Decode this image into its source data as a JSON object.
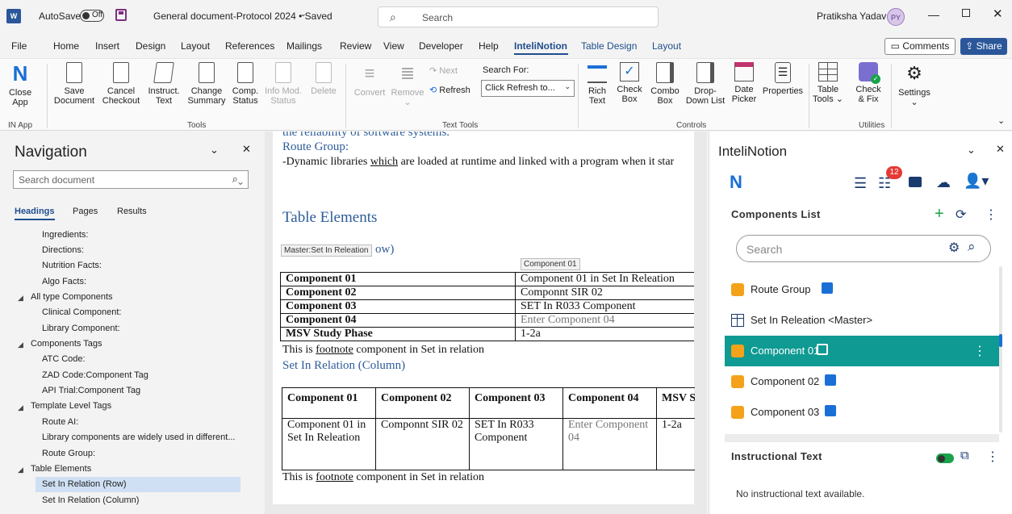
{
  "titlebar": {
    "autosave_label": "AutoSave",
    "autosave_state": "Off",
    "doc_title": "General document-Protocol 2024 • Saved",
    "search_placeholder": "Search",
    "user_name": "Pratiksha Yadav",
    "user_initials": "PY"
  },
  "menu": {
    "items": [
      "File",
      "Home",
      "Insert",
      "Design",
      "Layout",
      "References",
      "Mailings",
      "Review",
      "View",
      "Developer",
      "Help",
      "InteliNotion",
      "Table Design",
      "Layout"
    ],
    "comments": "Comments",
    "share": "Share"
  },
  "ribbon": {
    "groups": {
      "in_app": "IN App",
      "tools": "Tools",
      "text_tools": "Text Tools",
      "controls": "Controls",
      "utilities": "Utilities"
    },
    "buttons": {
      "close_app": [
        "Close",
        "App"
      ],
      "save_doc": [
        "Save",
        "Document"
      ],
      "cancel_checkout": [
        "Cancel",
        "Checkout"
      ],
      "instruct_text": [
        "Instruct.",
        "Text"
      ],
      "change_summary": [
        "Change",
        "Summary"
      ],
      "comp_status": [
        "Comp.",
        "Status"
      ],
      "info_mod_status": [
        "Info Mod.",
        "Status"
      ],
      "delete": "Delete",
      "convert": "Convert",
      "remove": "Remove",
      "next": "Next",
      "refresh": "Refresh",
      "search_for_label": "Search For:",
      "search_for_value": "Click Refresh to...",
      "rich_text": [
        "Rich",
        "Text"
      ],
      "check_box": [
        "Check",
        "Box"
      ],
      "combo_box": [
        "Combo",
        "Box"
      ],
      "dropdown_list": [
        "Drop-",
        "Down List"
      ],
      "date_picker": [
        "Date",
        "Picker"
      ],
      "properties": "Properties",
      "table_tools": [
        "Table",
        "Tools"
      ],
      "check_fix": [
        "Check",
        "& Fix"
      ],
      "settings": "Settings"
    }
  },
  "navigation": {
    "title": "Navigation",
    "search_placeholder": "Search document",
    "tabs": [
      "Headings",
      "Pages",
      "Results"
    ],
    "items": [
      {
        "label": "Ingredients:",
        "level": 2
      },
      {
        "label": "Directions:",
        "level": 2
      },
      {
        "label": "Nutrition Facts:",
        "level": 2
      },
      {
        "label": "Algo Facts:",
        "level": 2
      },
      {
        "label": "All type Components",
        "level": 1
      },
      {
        "label": "Clinical Component:",
        "level": 2
      },
      {
        "label": "Library Component:",
        "level": 2
      },
      {
        "label": "Components Tags",
        "level": 1
      },
      {
        "label": "ATC Code:",
        "level": 2
      },
      {
        "label": "ZAD Code:Component Tag",
        "level": 2
      },
      {
        "label": "API Trial:Component Tag",
        "level": 2
      },
      {
        "label": "Template Level Tags",
        "level": 1
      },
      {
        "label": "Route AI:",
        "level": 2
      },
      {
        "label": "Library components are widely used in different...",
        "level": 2
      },
      {
        "label": "Route Group:",
        "level": 2
      },
      {
        "label": "Table Elements",
        "level": 1
      },
      {
        "label": "Set In Relation (Row)",
        "level": 2,
        "selected": true
      },
      {
        "label": "Set In Relation (Column)",
        "level": 2
      }
    ]
  },
  "document": {
    "cut_line": "the reliability of software systems.",
    "route_group_heading": "Route Group:",
    "route_group_text_pre": "-Dynamic libraries ",
    "route_group_text_which": "which",
    "route_group_text_post": "  are loaded at runtime and linked with a program when it star",
    "table_elements_heading": "Table Elements",
    "row_heading_tail": "ow)",
    "master_tag": "Master:Set In Releation",
    "component_tag": "Component 01",
    "row_table": [
      [
        "Component 01",
        "Component 01 in Set In Releation"
      ],
      [
        "Component 02",
        "Componnt SIR 02"
      ],
      [
        "Component 03",
        "SET In R033 Component"
      ],
      [
        "Component 04",
        "Enter Component 04"
      ],
      [
        "MSV Study Phase",
        "1-2a"
      ]
    ],
    "footnote_pre": "This is ",
    "footnote_link": "footnote",
    "footnote_post": " component in Set in relation",
    "column_heading": "Set In Relation (Column)",
    "col_table_headers": [
      "Component 01",
      "Component 02",
      "Component 03",
      "Component 04",
      "MSV S Phase"
    ],
    "col_table_values": [
      "Component 01 in Set In Releation",
      "Componnt SIR 02",
      "SET In R033 Component",
      "Enter Component 04",
      "1-2a"
    ]
  },
  "intelinotion": {
    "title": "InteliNotion",
    "badge": "12",
    "components_list_title": "Components List",
    "search_placeholder": "Search",
    "items": [
      {
        "label": "Route Group",
        "icon": "puzzle-icon",
        "locked": true
      },
      {
        "label": "Set In Releation <Master>",
        "icon": "table-icon",
        "locked": false
      },
      {
        "label": "Component 01",
        "icon": "puzzle-icon",
        "locked": true,
        "selected": true
      },
      {
        "label": "Component 02",
        "icon": "puzzle-icon",
        "locked": true
      },
      {
        "label": "Component 03",
        "icon": "puzzle-icon",
        "locked": true
      }
    ],
    "instructional_title": "Instructional Text",
    "instructional_empty": "No instructional text available."
  },
  "colors": {
    "accent_teal": "#0f9a93",
    "word_blue": "#2b579a",
    "doc_heading_blue": "#2e5c9a",
    "puzzle_orange": "#f3a21a",
    "badge_red": "#e53935"
  }
}
